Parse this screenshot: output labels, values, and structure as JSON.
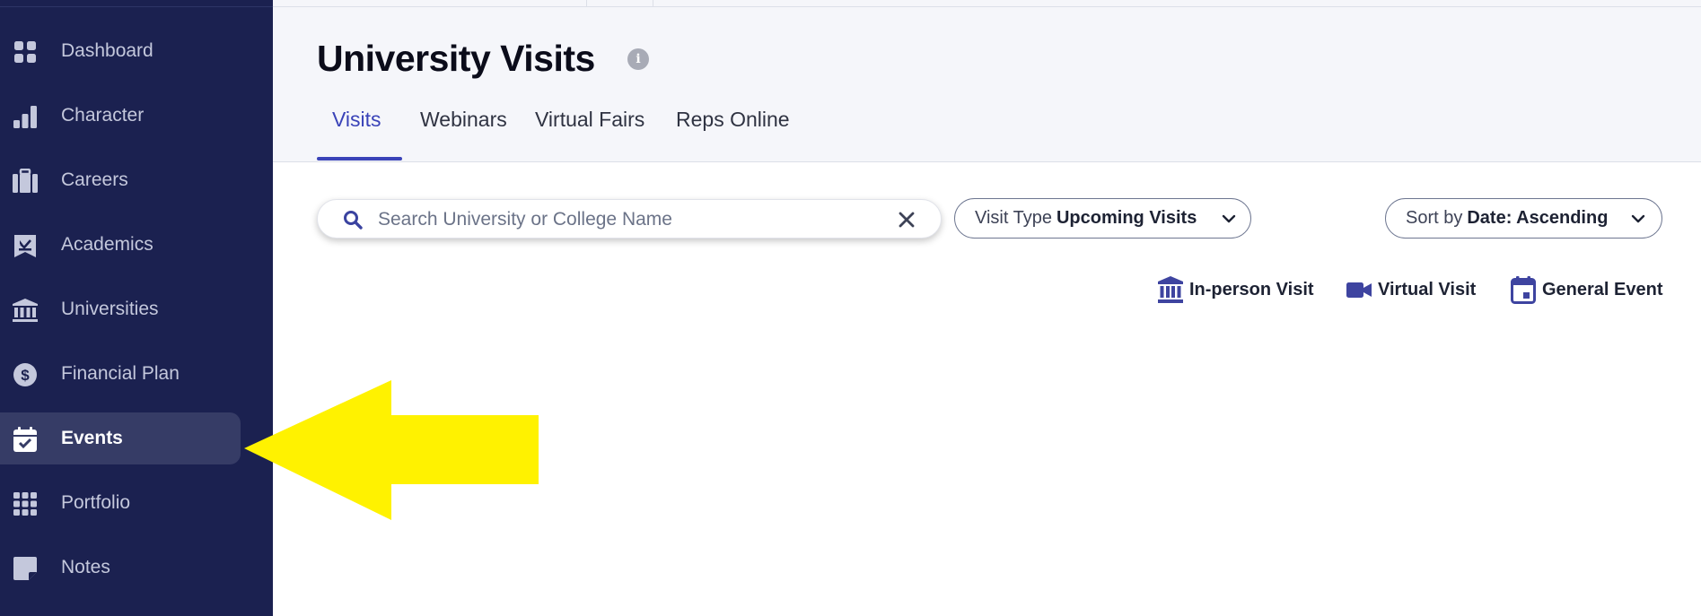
{
  "sidebar": {
    "items": [
      {
        "label": "Dashboard",
        "icon": "dashboard-icon"
      },
      {
        "label": "Character",
        "icon": "bar-chart-icon"
      },
      {
        "label": "Careers",
        "icon": "briefcase-icon"
      },
      {
        "label": "Academics",
        "icon": "academics-icon"
      },
      {
        "label": "Universities",
        "icon": "university-icon"
      },
      {
        "label": "Financial Plan",
        "icon": "dollar-icon"
      },
      {
        "label": "Events",
        "icon": "calendar-check-icon",
        "active": true
      },
      {
        "label": "Portfolio",
        "icon": "grid-dots-icon"
      },
      {
        "label": "Notes",
        "icon": "note-icon"
      }
    ]
  },
  "header": {
    "title": "University Visits",
    "info_icon": "i",
    "tabs": [
      {
        "label": "Visits",
        "active": true
      },
      {
        "label": "Webinars"
      },
      {
        "label": "Virtual Fairs"
      },
      {
        "label": "Reps Online"
      }
    ]
  },
  "filters": {
    "search_placeholder": "Search University or College Name",
    "search_value": "",
    "visit_type_prefix": "Visit Type",
    "visit_type_value": "Upcoming Visits",
    "sort_prefix": "Sort by",
    "sort_value": "Date: Ascending"
  },
  "legend": [
    {
      "label": "In-person Visit",
      "icon": "university-icon"
    },
    {
      "label": "Virtual Visit",
      "icon": "video-camera-icon"
    },
    {
      "label": "General Event",
      "icon": "calendar-icon"
    }
  ],
  "colors": {
    "sidebar_bg": "#1b2150",
    "sidebar_active_bg": "#363c66",
    "accent": "#3a43b8",
    "annotation_arrow": "#fff200"
  }
}
